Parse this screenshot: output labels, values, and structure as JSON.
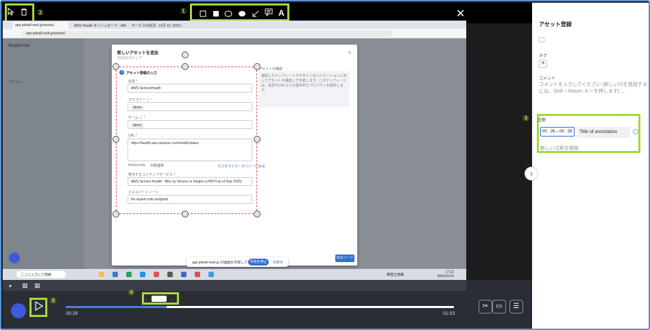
{
  "toolbar": {
    "markers": {
      "m1": "①",
      "m2": "②",
      "m3": "③",
      "m4": "④",
      "m5": "⑤"
    },
    "close": "✕",
    "text_tool": "A",
    "icons": [
      "pointer-icon",
      "trash-icon",
      "square-outline-icon",
      "square-filled-icon",
      "ellipse-outline-icon",
      "ellipse-filled-icon",
      "arrow-icon",
      "speech-bubble-icon",
      "text-icon"
    ]
  },
  "browser": {
    "tab1": "app.pitwall-web.jp/assets/",
    "tab2": "AWS Health ダッシュボード - AW",
    "tab3": "サービスの状況 - 11月 10, 2025 |",
    "address": "app.pitwall-web.jp/assets/"
  },
  "app": {
    "brand": "StageCrew",
    "sidebar_item": "アセット",
    "modal": {
      "title": "新しいアセットを追加",
      "subtitle": "3分の1ステップ",
      "section": "アセット情報の入力",
      "name_label": "名前 *",
      "name_value": "AWS ServiceHealth",
      "category_label": "カテゴリー ⓘ *",
      "category_chip": "demo",
      "team_label": "チーム ⓘ *",
      "team_chip": "demo",
      "url_label": "URL *",
      "url_value": "https://health.aws.amazon.com/health/status",
      "iframe_opt1": "iframe-only",
      "iframe_opt2": "印刷連携",
      "customize_link": "カスタマイズ・ポリシーに戻る",
      "source_label": "表示するコンテンツサービス *",
      "source_value": "AWS Service Health - filter by Service or Region (cPATH as of Sep 2025)",
      "expert_label": "エキスパートノート",
      "expert_value": "No expert note assigned",
      "side_title": "アセットの構成",
      "side_text": "選択したテンプレートやデザインのバリエーションに対してアセットを構成して作成します。このテンプレートは、名前やURLなどの基本的なプロパティを提供します。",
      "next_label": "次のページ"
    },
    "share": {
      "text": "app.pitwall-web.jp が画面を共有しています。",
      "button": "共有を停止",
      "hide": "非表示"
    },
    "taskbar": {
      "search": "ここに入力して検索",
      "weather": "降雪注意報",
      "clock": "17:22",
      "date": "2025/11/10"
    }
  },
  "player": {
    "current_time": "00:28",
    "total_time": "01:53",
    "progress": 0.26
  },
  "panel": {
    "title": "アセット登録",
    "tag_label": "タグ",
    "add_tag": "+",
    "comment_label": "コメント",
    "comment_placeholder": "コメントを入力してください (新しい行を追加するには、Shift + Return キーを押します) ...",
    "annotation_label": "注釈",
    "time_range": "00 : 26 – 00 : 28",
    "annotation_title": "Title of annotation",
    "new_annotation": "新しい注釈を開始",
    "expand": "›"
  },
  "colors": {
    "highlight": "#a6d93b",
    "accent": "#2f6fd6",
    "selection": "#e0524d"
  }
}
